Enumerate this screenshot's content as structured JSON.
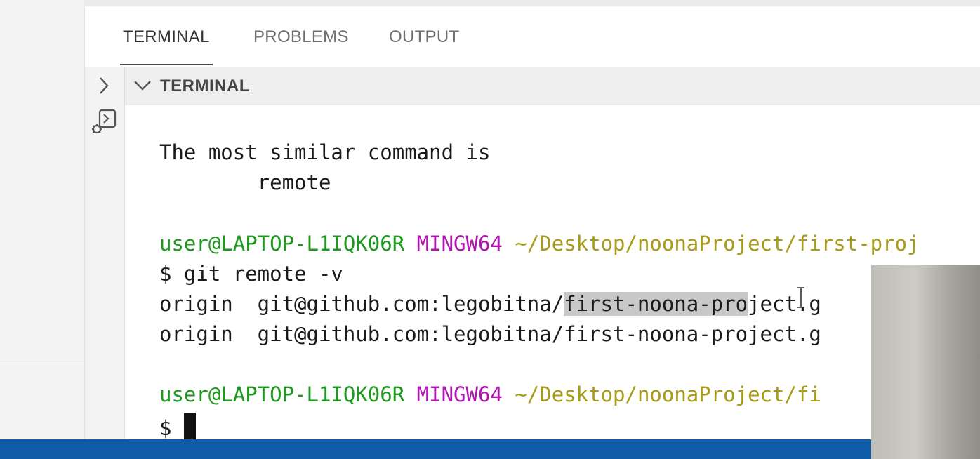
{
  "tabs": [
    {
      "label": "TERMINAL",
      "active": true
    },
    {
      "label": "PROBLEMS",
      "active": false
    },
    {
      "label": "OUTPUT",
      "active": false
    }
  ],
  "section": {
    "title": "TERMINAL"
  },
  "terminal": {
    "line1": "The most similar command is",
    "line2": "        remote",
    "prompt1": {
      "user": "user@LAPTOP-L1IQK06R",
      "host": "MINGW64",
      "path": "~/Desktop/noonaProject/first-proj"
    },
    "cmd": "$ git remote -v",
    "out1": {
      "pre": "origin  git@github.com:legobitna/",
      "hl": "first-noona-pro",
      "post": "ject.g"
    },
    "out2": "origin  git@github.com:legobitna/first-noona-project.g",
    "prompt2": {
      "user": "user@LAPTOP-L1IQK06R",
      "host": "MINGW64",
      "path": "~/Desktop/noonaProject/fi"
    },
    "input_prompt": "$ "
  },
  "colors": {
    "prompt_user": "#1d9a1d",
    "prompt_host": "#b315b3",
    "prompt_path": "#a89b17",
    "status_bar": "#0f5ba8"
  },
  "icons": [
    "chevron-right-icon",
    "debug-console-icon",
    "chevron-down-icon"
  ]
}
